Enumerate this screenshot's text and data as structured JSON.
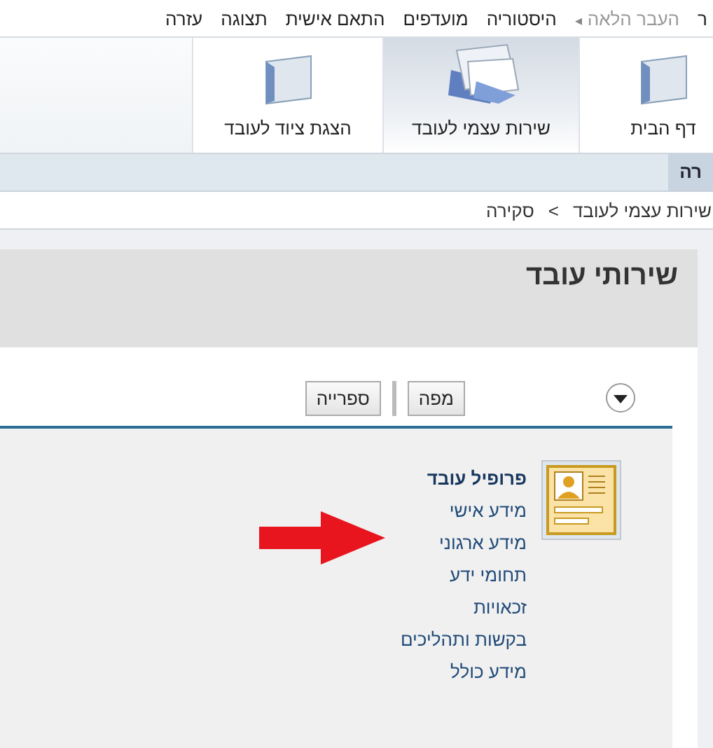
{
  "menu": [
    {
      "label": "ר",
      "disabled": false
    },
    {
      "label": "העבר הלאה",
      "disabled": true,
      "arrow": "◂"
    },
    {
      "label": "היסטוריה",
      "disabled": false
    },
    {
      "label": "מועדפים",
      "disabled": false
    },
    {
      "label": "התאם אישית",
      "disabled": false
    },
    {
      "label": "תצוגה",
      "disabled": false
    },
    {
      "label": "עזרה",
      "disabled": false
    }
  ],
  "tabs": [
    {
      "label": "דף הבית",
      "selected": false,
      "kind": "folder"
    },
    {
      "label": "שירות עצמי לעובד",
      "selected": true,
      "kind": "papers"
    },
    {
      "label": "הצגת ציוד לעובד",
      "selected": false,
      "kind": "folder"
    }
  ],
  "subnav": {
    "label": "רה"
  },
  "breadcrumb": {
    "items": [
      "שירות עצמי לעובד",
      "סקירה"
    ],
    "separator": ">"
  },
  "page_title": "שירותי עובד",
  "toolbar": {
    "buttons": [
      "מפה",
      "ספרייה"
    ]
  },
  "section": {
    "title": "פרופיל עובד",
    "links": [
      "מידע אישי",
      "מידע ארגוני",
      "תחומי ידע",
      "זכאויות",
      "בקשות ותהליכים",
      "מידע כולל"
    ]
  }
}
